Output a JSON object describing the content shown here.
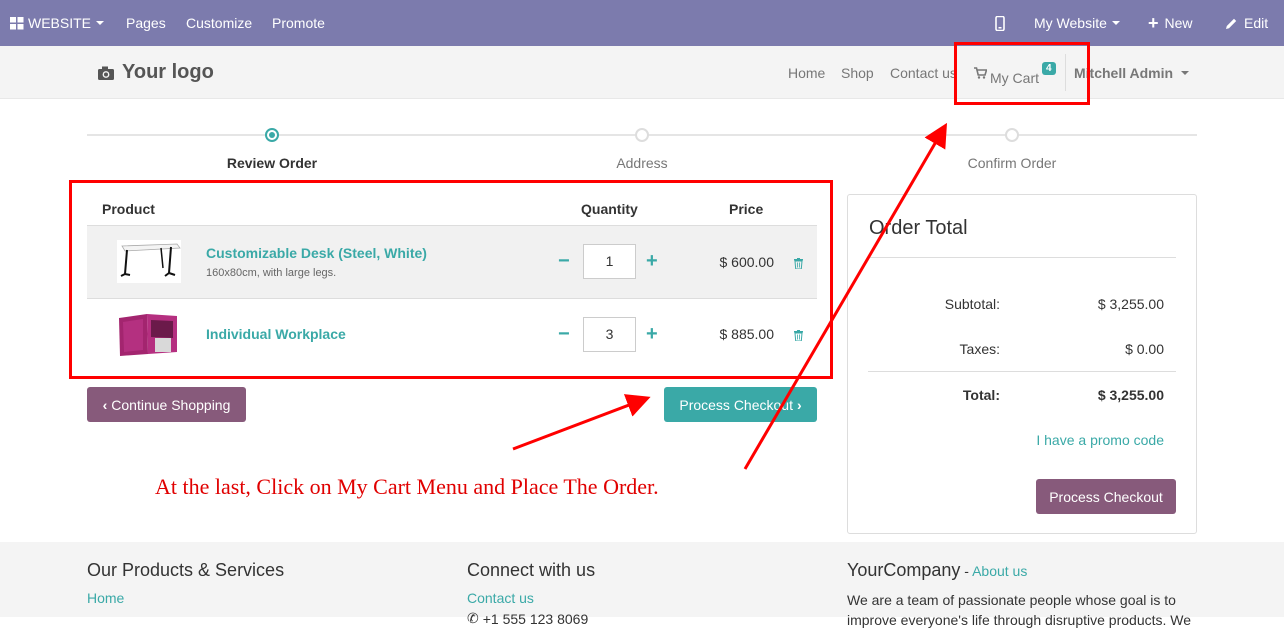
{
  "admin_bar": {
    "website_label": "WEBSITE",
    "menu": [
      "Pages",
      "Customize",
      "Promote"
    ],
    "my_website_label": "My Website",
    "new_label": "New",
    "edit_label": "Edit"
  },
  "navbar": {
    "logo_text": "Your logo",
    "links": [
      "Home",
      "Shop",
      "Contact us"
    ],
    "cart_label": "My Cart",
    "cart_count": "4",
    "user_label": "Mitchell Admin"
  },
  "steps": [
    {
      "label": "Review Order",
      "active": true
    },
    {
      "label": "Address",
      "active": false
    },
    {
      "label": "Confirm Order",
      "active": false
    }
  ],
  "cart": {
    "headers": {
      "product": "Product",
      "quantity": "Quantity",
      "price": "Price"
    },
    "items": [
      {
        "name": "Customizable Desk (Steel, White)",
        "description": "160x80cm, with large legs.",
        "quantity": "1",
        "price": "$ 600.00"
      },
      {
        "name": "Individual Workplace",
        "description": "",
        "quantity": "3",
        "price": "$ 885.00"
      }
    ]
  },
  "buttons": {
    "continue_shopping": "Continue Shopping",
    "process_checkout": "Process Checkout"
  },
  "order_total": {
    "title": "Order Total",
    "subtotal_label": "Subtotal:",
    "subtotal_value": "$ 3,255.00",
    "taxes_label": "Taxes:",
    "taxes_value": "$ 0.00",
    "total_label": "Total:",
    "total_value": "$ 3,255.00",
    "promo_link": "I have a promo code",
    "checkout_button": "Process Checkout"
  },
  "annotation": {
    "text": "At the last, Click on My Cart Menu and Place The Order.",
    "color": "#ff0000"
  },
  "footer": {
    "products_title": "Our Products & Services",
    "products_links": [
      "Home"
    ],
    "connect_title": "Connect with us",
    "connect_links": [
      "Contact us"
    ],
    "connect_phone": "+1 555 123 8069",
    "company_name": "YourCompany",
    "company_about_link": "About us",
    "company_text": "We are a team of passionate people whose goal is to improve everyone's life through disruptive products. We"
  },
  "colors": {
    "admin_bar": "#7c7bad",
    "accent": "#3aa9a7",
    "secondary_button": "#875a7b"
  }
}
